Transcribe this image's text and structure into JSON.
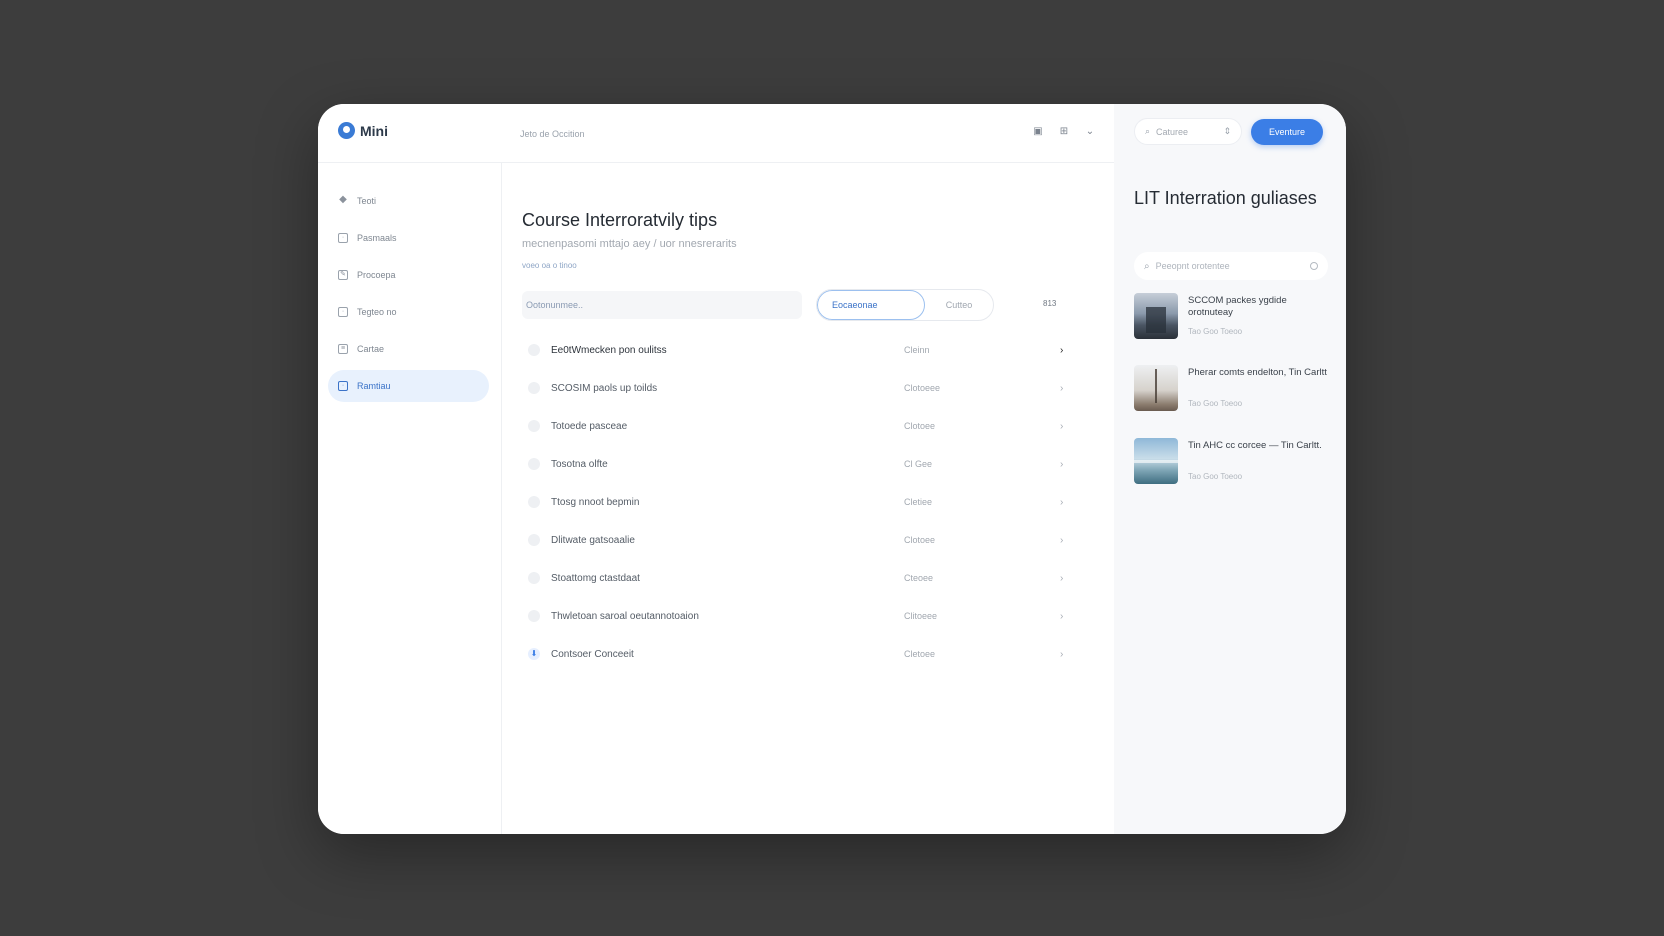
{
  "app": {
    "name": "Mini"
  },
  "header": {
    "breadcrumb": "Jeto de Occition",
    "icons": [
      "image-icon",
      "grid-icon",
      "chevron-down-icon"
    ]
  },
  "toolbar": {
    "select_value": "Caturee",
    "primary_label": "Eventure"
  },
  "sidebar": {
    "items": [
      {
        "label": "Teoti",
        "icon": "graduation-cap-icon",
        "active": false
      },
      {
        "label": "Pasmaals",
        "icon": "page-icon",
        "active": false
      },
      {
        "label": "Procoepa",
        "icon": "edit-icon",
        "active": false
      },
      {
        "label": "Tegteo no",
        "icon": "message-icon",
        "active": false
      },
      {
        "label": "Cartae",
        "icon": "list-icon",
        "active": false
      },
      {
        "label": "Ramtiau",
        "icon": "doc-icon",
        "active": true
      }
    ]
  },
  "main": {
    "title": "Course Interroratvily tips",
    "subtitle": "mecnenpasomi mttajo aey / uor nnesrerarits",
    "meta": "voeo oa o tinoo",
    "filter_label": "Ootonunmee..",
    "segment": {
      "active": "Eocaeonae",
      "inactive": "Cutteo"
    },
    "count": "813",
    "rows": [
      {
        "label": "Ee0tWmecken pon oulitss",
        "status": "Cleinn",
        "strong": true,
        "done": false
      },
      {
        "label": "SCOSIM paols up toilds",
        "status": "Clotoeee",
        "strong": false,
        "done": false
      },
      {
        "label": "Totoede pasceae",
        "status": "Clotoee",
        "strong": false,
        "done": false
      },
      {
        "label": "Tosotna olfte",
        "status": "Cl Gee",
        "strong": false,
        "done": false
      },
      {
        "label": "Ttosg nnoot bepmin",
        "status": "Cletiee",
        "strong": false,
        "done": false
      },
      {
        "label": "Dlitwate gatsoaalie",
        "status": "Clotoee",
        "strong": false,
        "done": false
      },
      {
        "label": "Stoattomg ctastdaat",
        "status": "Cteoee",
        "strong": false,
        "done": false
      },
      {
        "label": "Thwletoan saroal oeutannotoaion",
        "status": "Clitoeee",
        "strong": false,
        "done": false
      },
      {
        "label": "Contsoer Conceeit",
        "status": "Cletoee",
        "strong": false,
        "done": true
      }
    ]
  },
  "right_panel": {
    "title": "LIT Interration guliases",
    "search_placeholder": "Peeopnt orotentee",
    "cards": [
      {
        "title": "SCCOM packes ygdide orotnuteay",
        "meta": "Tao Goo Toeoo"
      },
      {
        "title": "Pherar comts endelton, Tin Carltt",
        "meta": "Tao Goo Toeoo"
      },
      {
        "title": "Tin AHC cc corcee — Tin Carltt.",
        "meta": "Tao Goo Toeoo"
      }
    ]
  }
}
